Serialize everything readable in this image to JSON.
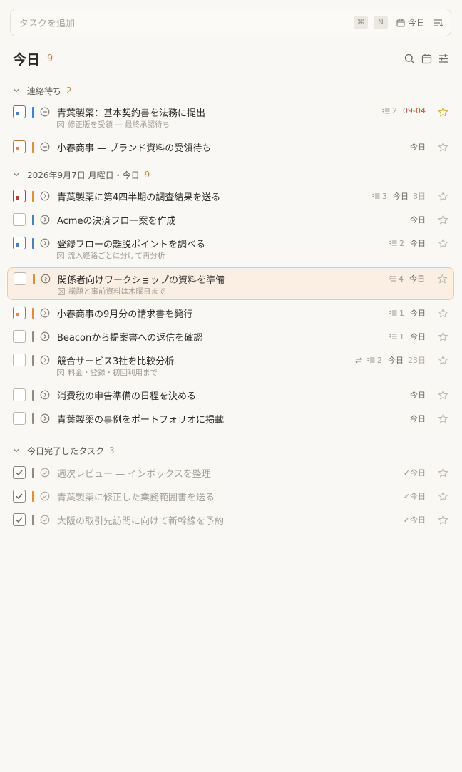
{
  "add_bar": {
    "placeholder": "タスクを追加",
    "shortcut_cmd": "⌘",
    "shortcut_key": "N",
    "today_label": "今日"
  },
  "header": {
    "title": "今日",
    "count": "9"
  },
  "colors": {
    "accent": "#c58a3a",
    "priority_blue": "#4a7fc1",
    "priority_orange": "#d99336",
    "priority_red": "#c0392b",
    "priority_gray": "#8f8a84",
    "star_gold": "#e0a93a",
    "overdue_red": "#c05a3c",
    "highlight_bg": "#fbeee3"
  },
  "sections": {
    "waiting": {
      "label": "連絡待ち",
      "count": "2"
    },
    "today": {
      "label": "2026年9月7日 月曜日・今日",
      "count": "9"
    },
    "done": {
      "label": "今日完了したタスク",
      "count": "3"
    }
  },
  "waiting_tasks": [
    {
      "title": "青葉製薬：基本契約書を法務に提出",
      "note": "修正版を受領 — 最終承認待ち",
      "subtasks": "2",
      "date": "09-04",
      "date_style": "overdue",
      "starred": true,
      "flag": "blue",
      "priority": "blue",
      "status_icon": "waiting-icon"
    },
    {
      "title": "小春商事 — ブランド資料の受領待ち",
      "date": "今日",
      "starred": false,
      "flag": "orange",
      "priority": "orange",
      "status_icon": "waiting-icon"
    }
  ],
  "today_tasks": [
    {
      "title": "青葉製薬に第4四半期の調査結果を送る",
      "subtasks": "3",
      "date": "今日",
      "due": "8日",
      "flag": "red",
      "priority": "orange",
      "status_icon": "forward-icon"
    },
    {
      "title": "Acmeの決済フロー案を作成",
      "date": "今日",
      "flag": "none",
      "priority": "blue",
      "status_icon": "forward-icon"
    },
    {
      "title": "登録フローの離脱ポイントを調べる",
      "note": "流入経路ごとに分けて再分析",
      "subtasks": "2",
      "date": "今日",
      "flag": "blue",
      "priority": "blue",
      "status_icon": "forward-icon"
    },
    {
      "title": "関係者向けワークショップの資料を準備",
      "note": "議題と事前資料は木曜日まで",
      "subtasks": "4",
      "date": "今日",
      "flag": "none",
      "priority": "orange",
      "status_icon": "forward-icon",
      "highlighted": true
    },
    {
      "title": "小春商事の9月分の請求書を発行",
      "subtasks": "1",
      "date": "今日",
      "flag": "orange",
      "priority": "orange",
      "status_icon": "forward-icon"
    },
    {
      "title": "Beaconから提案書への返信を確認",
      "subtasks": "1",
      "date": "今日",
      "flag": "none",
      "priority": "gray",
      "status_icon": "forward-icon"
    },
    {
      "title": "競合サービス3社を比較分析",
      "note": "料金・登録・初回利用まで",
      "repeat": true,
      "subtasks": "2",
      "date": "今日",
      "due": "23日",
      "flag": "none",
      "priority": "gray",
      "status_icon": "forward-icon"
    },
    {
      "title": "消費税の申告準備の日程を決める",
      "date": "今日",
      "flag": "none",
      "priority": "gray",
      "status_icon": "forward-icon"
    },
    {
      "title": "青葉製薬の事例をポートフォリオに掲載",
      "date": "今日",
      "flag": "none",
      "priority": "gray",
      "status_icon": "forward-icon"
    }
  ],
  "done_tasks": [
    {
      "title": "週次レビュー — インボックスを整理",
      "date": "✓今日",
      "priority": "gray"
    },
    {
      "title": "青葉製薬に修正した業務範囲書を送る",
      "date": "✓今日",
      "priority": "orange"
    },
    {
      "title": "大阪の取引先訪問に向けて新幹線を予約",
      "date": "✓今日",
      "priority": "gray"
    }
  ]
}
